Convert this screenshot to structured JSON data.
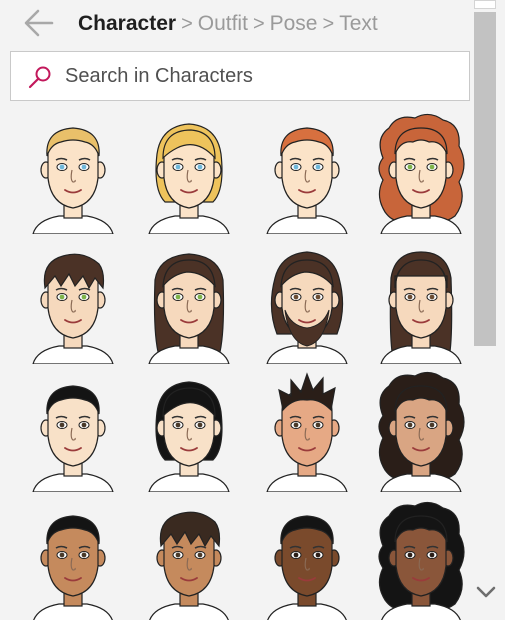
{
  "header": {
    "back_icon": "arrow-left-icon",
    "breadcrumbs": [
      {
        "label": "Character",
        "active": true
      },
      {
        "label": "Outfit",
        "active": false
      },
      {
        "label": "Pose",
        "active": false
      },
      {
        "label": "Text",
        "active": false
      }
    ],
    "separator": ">"
  },
  "search": {
    "placeholder": "Search in Characters",
    "value": "",
    "icon": "search-icon",
    "accent_color": "#c2185b"
  },
  "characters": [
    {
      "name": "character-1",
      "skin": "#fbe3c8",
      "hair": "#e9c06a",
      "style": "short",
      "eyes": "#6fb7d9",
      "beard": false
    },
    {
      "name": "character-2",
      "skin": "#fbe3c8",
      "hair": "#eec35c",
      "style": "bob",
      "eyes": "#6fb7d9",
      "beard": false
    },
    {
      "name": "character-3",
      "skin": "#fbe3c8",
      "hair": "#d7703f",
      "style": "short",
      "eyes": "#6fb7d9",
      "beard": false
    },
    {
      "name": "character-4",
      "skin": "#fbe3c8",
      "hair": "#c8653a",
      "style": "curly",
      "eyes": "#7eb34a",
      "beard": false
    },
    {
      "name": "character-5",
      "skin": "#f6d9bd",
      "hair": "#4b3226",
      "style": "shaggy",
      "eyes": "#7eb34a",
      "beard": false
    },
    {
      "name": "character-6",
      "skin": "#f6d9bd",
      "hair": "#4b3226",
      "style": "long",
      "eyes": "#7eb34a",
      "beard": false
    },
    {
      "name": "character-7",
      "skin": "#f6d9bd",
      "hair": "#4b3226",
      "style": "wavy",
      "eyes": "#6b4d33",
      "beard": true
    },
    {
      "name": "character-8",
      "skin": "#f6d9bd",
      "hair": "#4b3226",
      "style": "straight",
      "eyes": "#6b4d33",
      "beard": false
    },
    {
      "name": "character-9",
      "skin": "#f8e1c8",
      "hair": "#141414",
      "style": "short",
      "eyes": "#4a3a2a",
      "beard": false
    },
    {
      "name": "character-10",
      "skin": "#f8e1c8",
      "hair": "#141414",
      "style": "bob",
      "eyes": "#4a3a2a",
      "beard": false
    },
    {
      "name": "character-11",
      "skin": "#e6a985",
      "hair": "#2a1e18",
      "style": "spiky",
      "eyes": "#4a3a2a",
      "beard": false
    },
    {
      "name": "character-12",
      "skin": "#d9a583",
      "hair": "#2a1e18",
      "style": "curly",
      "eyes": "#4a3a2a",
      "beard": false
    },
    {
      "name": "character-13",
      "skin": "#c58a5d",
      "hair": "#141414",
      "style": "short",
      "eyes": "#4a3a2a",
      "beard": false
    },
    {
      "name": "character-14",
      "skin": "#c58a5d",
      "hair": "#3a2a20",
      "style": "shaggy",
      "eyes": "#4a3a2a",
      "beard": false
    },
    {
      "name": "character-15",
      "skin": "#7a4a2c",
      "hair": "#141414",
      "style": "short",
      "eyes": "#2a1e18",
      "beard": false
    },
    {
      "name": "character-16",
      "skin": "#8a563a",
      "hair": "#141414",
      "style": "curly",
      "eyes": "#2a1e18",
      "beard": false
    }
  ],
  "scrollbar": {
    "down_icon": "chevron-down-icon"
  }
}
